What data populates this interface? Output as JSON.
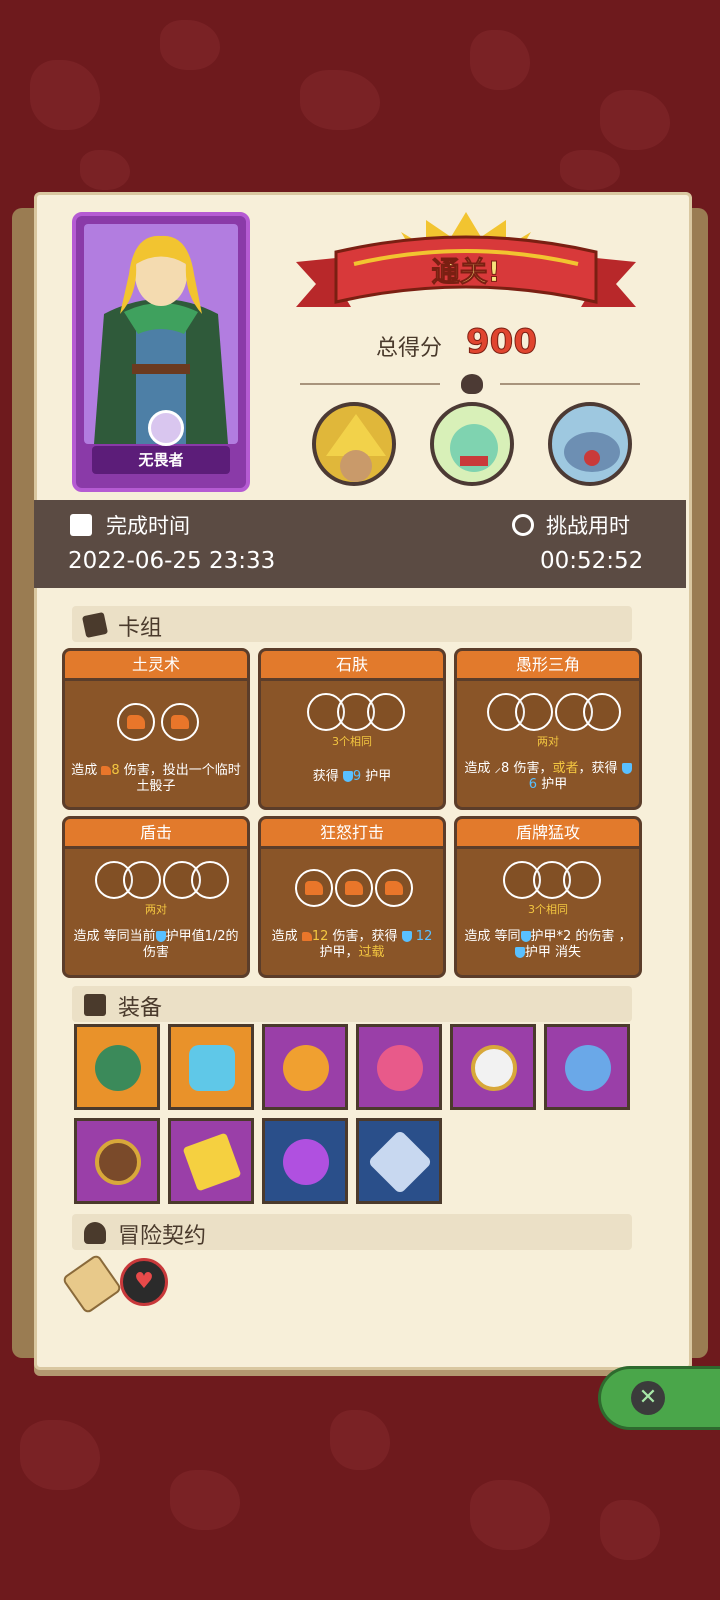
{
  "hero": {
    "name": "无畏者"
  },
  "result": {
    "banner": "通关!",
    "score_label": "总得分",
    "score": "900"
  },
  "time": {
    "complete_label": "完成时间",
    "complete_value": "2022-06-25 23:33",
    "challenge_label": "挑战用时",
    "challenge_value": "00:52:52"
  },
  "sections": {
    "deck": "卡组",
    "equipment": "装备",
    "contract": "冒险契约"
  },
  "cards": [
    {
      "title": "土灵术",
      "sub": "",
      "d1": "造成",
      "d2": "8",
      "d3": "伤害，投出一个临时土骰子"
    },
    {
      "title": "石肤",
      "sub": "3个相同",
      "d1": "获得",
      "d2": "9",
      "d3": "护甲"
    },
    {
      "title": "愚形三角",
      "sub": "两对",
      "d1": "造成",
      "d2": "8",
      "d3": "伤害，",
      "d4": "或者",
      "d5": "，获得",
      "d6": "6",
      "d7": "护甲"
    },
    {
      "title": "盾击",
      "sub": "两对",
      "d1": "造成 等同当前",
      "d2": "护甲值1/2的伤害"
    },
    {
      "title": "狂怒打击",
      "sub": "",
      "d1": "造成",
      "d2": "12",
      "d3": "伤害，获得",
      "d4": "12",
      "d5": "护甲，",
      "d6": "过载"
    },
    {
      "title": "盾牌猛攻",
      "sub": "3个相同",
      "d1": "造成 等同",
      "d2": "护甲*2 的伤害",
      "d3": "，",
      "d4": "护甲 消失"
    }
  ],
  "colors": {
    "accent_red": "#e0452f",
    "card_orange": "#e27a2c",
    "card_body": "#8a5528"
  },
  "icons": [
    "calendar-icon",
    "stopwatch-icon",
    "cards-icon",
    "box-icon",
    "person-icon",
    "close-icon"
  ]
}
